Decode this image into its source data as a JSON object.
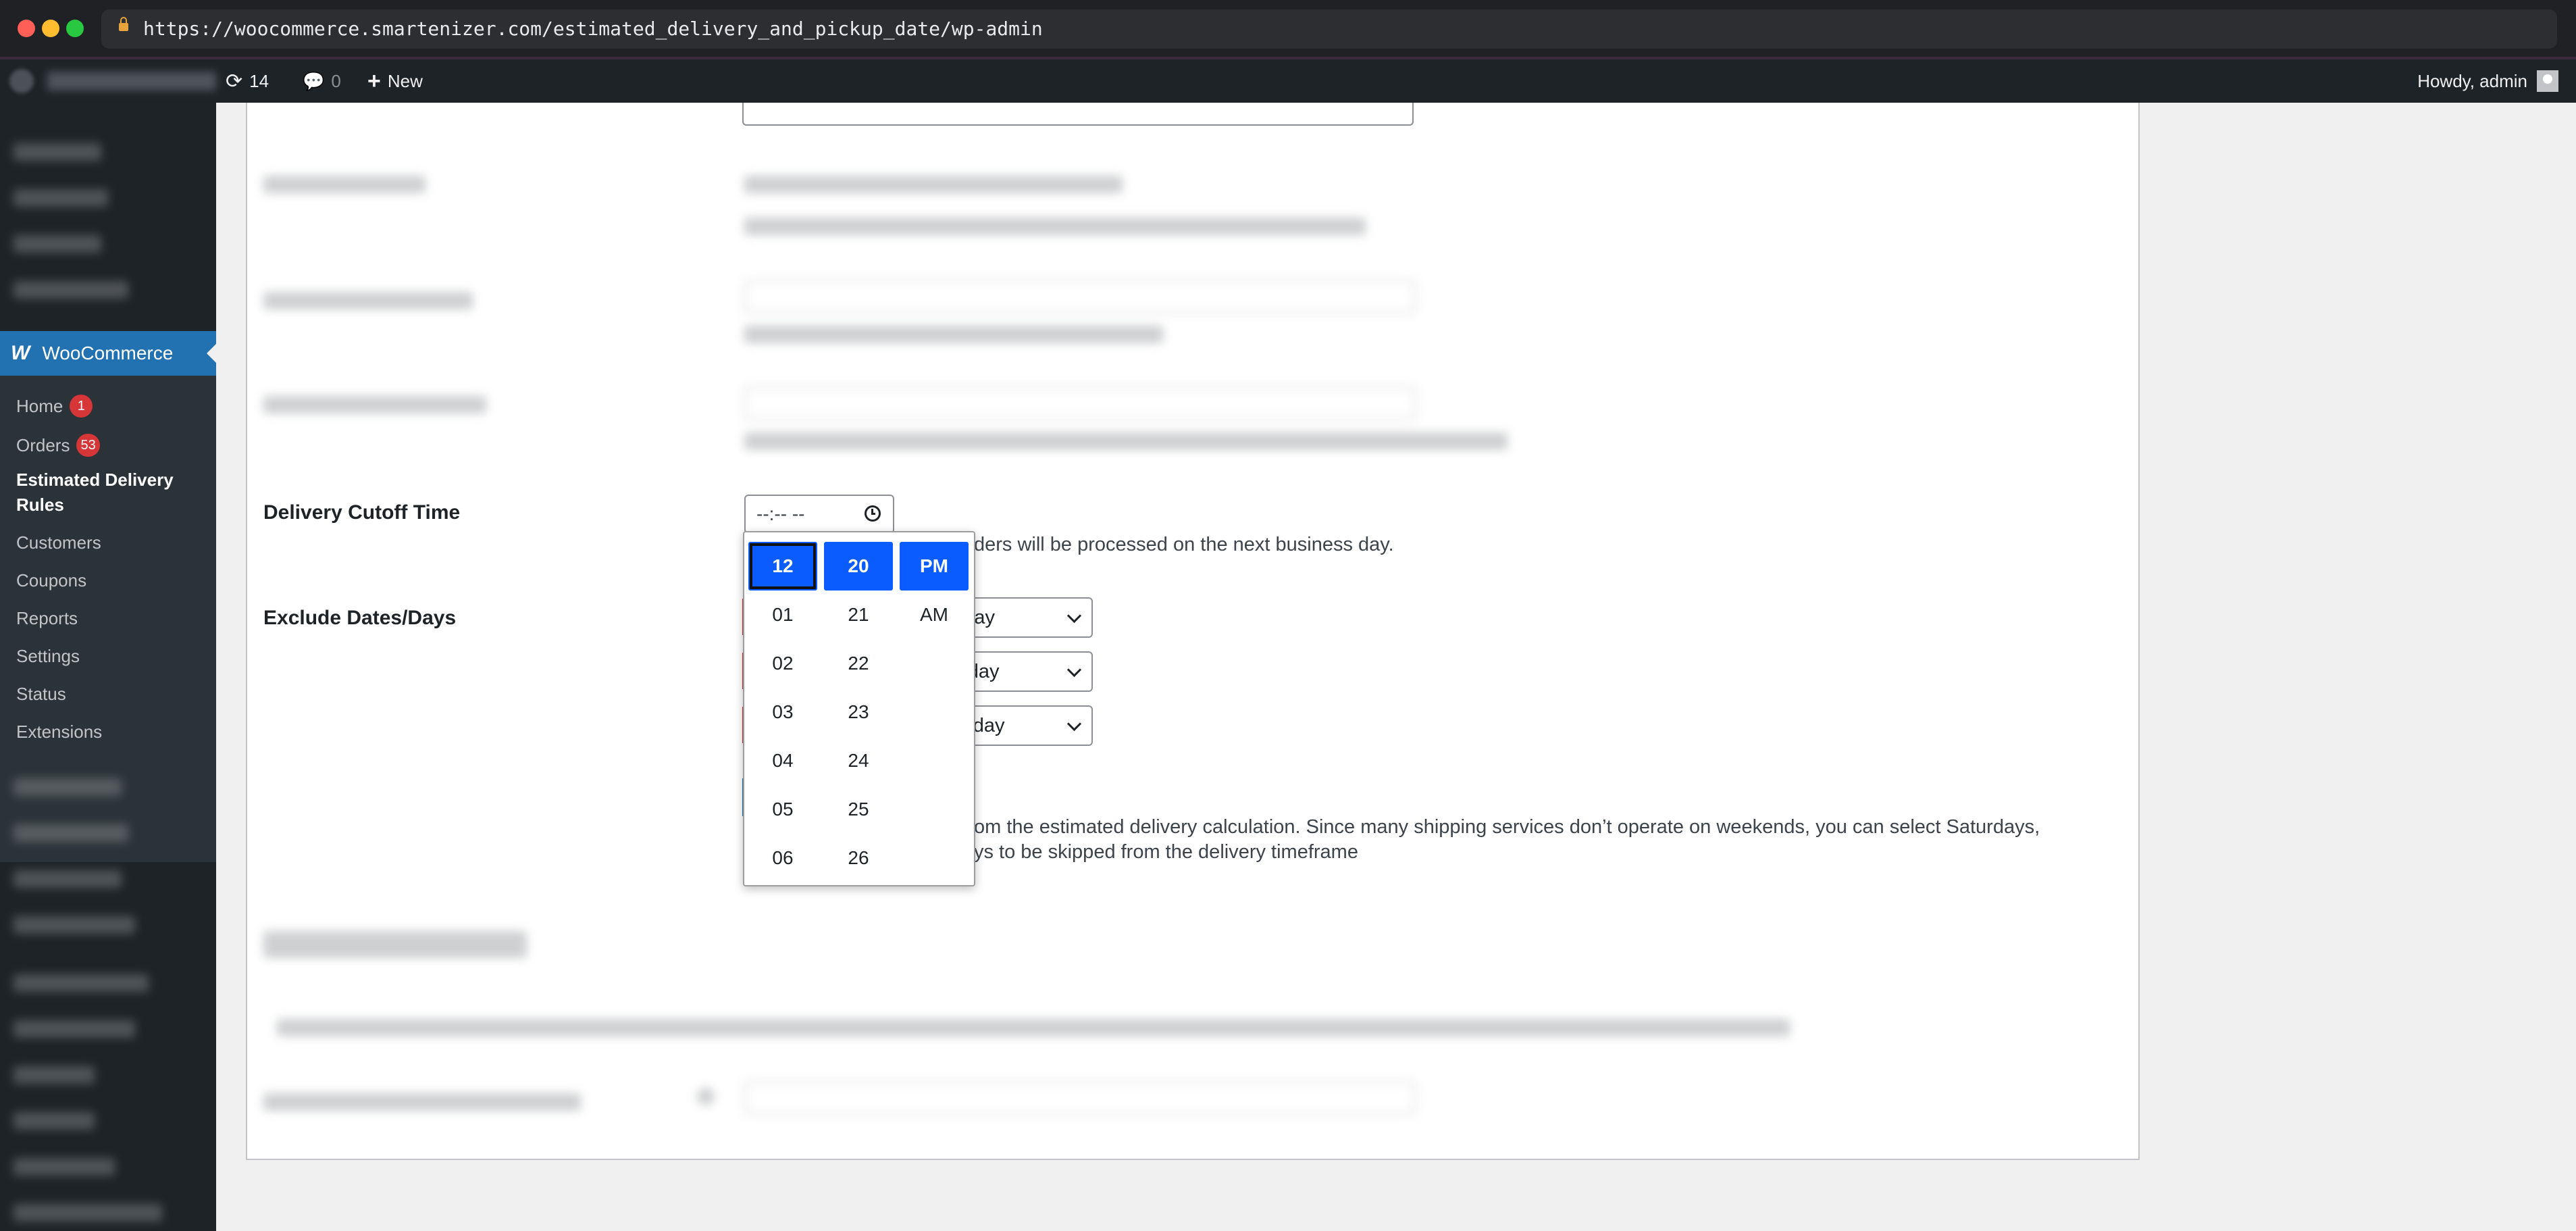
{
  "browser": {
    "url": "https://woocommerce.smartenizer.com/estimated_delivery_and_pickup_date/wp-admin"
  },
  "admin_bar": {
    "updates_count": "14",
    "comments_count": "0",
    "new_label": "New",
    "howdy": "Howdy, admin"
  },
  "sidebar": {
    "woocommerce_label": "WooCommerce",
    "items": [
      {
        "label": "Home",
        "badge": "1"
      },
      {
        "label": "Orders",
        "badge": "53"
      },
      {
        "label": "Estimated Delivery Rules"
      },
      {
        "label": "Customers"
      },
      {
        "label": "Coupons"
      },
      {
        "label": "Reports"
      },
      {
        "label": "Settings"
      },
      {
        "label": "Status"
      },
      {
        "label": "Extensions"
      }
    ]
  },
  "form": {
    "cutoff_label": "Delivery Cutoff Time",
    "cutoff_value": "--:-- --",
    "cutoff_desc_visible": "ders will be processed on the next business day.",
    "exclude_label": "Exclude Dates/Days",
    "exclude_selects": [
      "unday",
      "londay",
      "uesday"
    ],
    "exclude_desc_line1": "om the estimated delivery calculation. Since many shipping services don’t operate on weekends, you can select Saturdays,",
    "exclude_desc_line2": "ys to be skipped from the delivery timeframe"
  },
  "time_picker": {
    "hours": [
      "12",
      "01",
      "02",
      "03",
      "04",
      "05",
      "06"
    ],
    "minutes": [
      "20",
      "21",
      "22",
      "23",
      "24",
      "25",
      "26"
    ],
    "periods": [
      "PM",
      "AM"
    ],
    "selected_hour": "12",
    "selected_minute": "20",
    "selected_period": "PM"
  }
}
